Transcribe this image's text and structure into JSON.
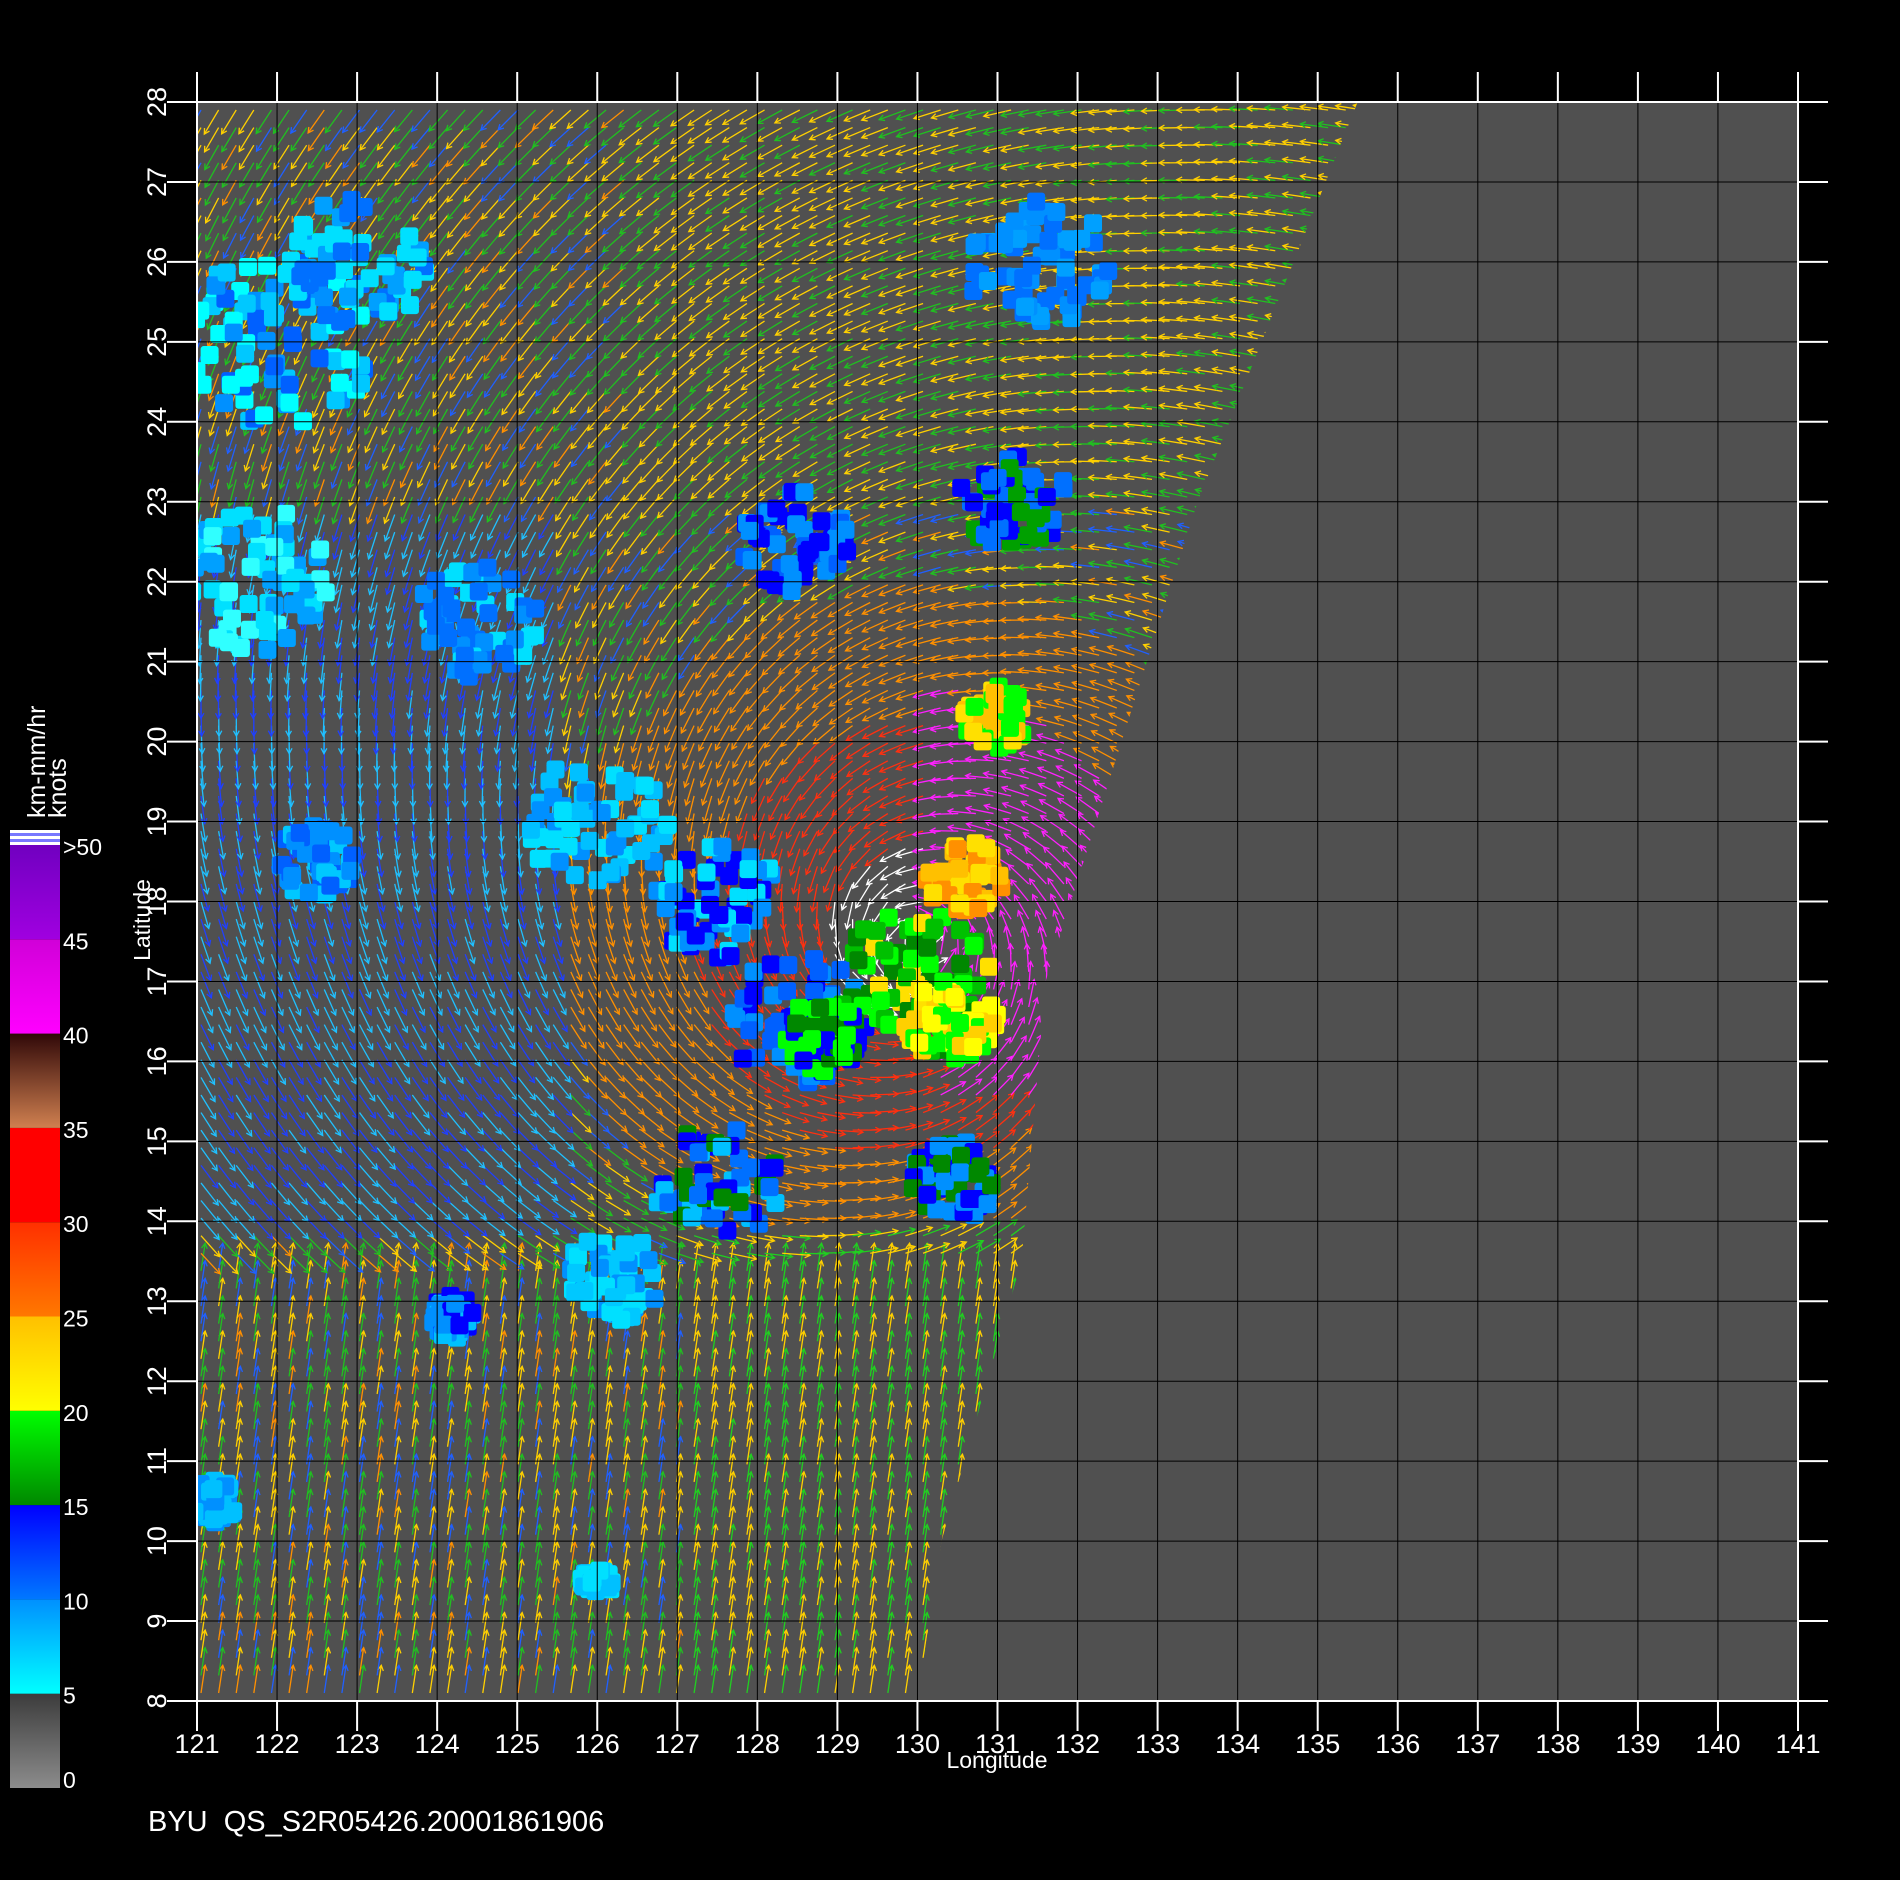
{
  "chart_data": {
    "type": "scatter",
    "x_axis": {
      "label": "Longitude",
      "range": [
        121,
        141
      ],
      "ticks": [
        121,
        122,
        123,
        124,
        125,
        126,
        127,
        128,
        129,
        130,
        131,
        132,
        133,
        134,
        135,
        136,
        137,
        138,
        139,
        140,
        141
      ]
    },
    "y_axis": {
      "label": "Latitude",
      "range": [
        8,
        28
      ],
      "ticks": [
        8,
        9,
        10,
        11,
        12,
        13,
        14,
        15,
        16,
        17,
        18,
        19,
        20,
        21,
        22,
        23,
        24,
        25,
        26,
        27,
        28
      ]
    },
    "grid": true,
    "plot_background": "#505050",
    "caption": "BYU  QS_S2R05426.20001861906",
    "colorbar": {
      "unit_rain": "km-mm/hr",
      "unit_wind": "knots",
      "labels": [
        "0",
        "5",
        "10",
        "15",
        "20",
        "25",
        "30",
        "35",
        "40",
        "45",
        ">50"
      ],
      "bins": [
        {
          "from": 0,
          "to": 5,
          "colors": [
            "#8c8c8c",
            "#3c3c3c"
          ]
        },
        {
          "from": 5,
          "to": 10,
          "colors": [
            "#00ffff",
            "#0090ff"
          ]
        },
        {
          "from": 10,
          "to": 15,
          "colors": [
            "#0078ff",
            "#0000ff"
          ]
        },
        {
          "from": 15,
          "to": 20,
          "colors": [
            "#008800",
            "#00ff00"
          ]
        },
        {
          "from": 20,
          "to": 25,
          "colors": [
            "#ffff00",
            "#ffc000"
          ]
        },
        {
          "from": 25,
          "to": 30,
          "colors": [
            "#ff7800",
            "#ff3000"
          ]
        },
        {
          "from": 30,
          "to": 35,
          "colors": [
            "#ff0000",
            "#ff0000"
          ]
        },
        {
          "from": 35,
          "to": 40,
          "colors": [
            "#d08050",
            "#300808"
          ]
        },
        {
          "from": 40,
          "to": 45,
          "colors": [
            "#ff00ff",
            "#d000d8"
          ]
        },
        {
          "from": 45,
          "to": 50,
          "colors": [
            "#a000e0",
            "#7000c0"
          ]
        }
      ],
      "top_stripes": [
        "#ffffff",
        "#7878ff",
        "#ffffff",
        "#7878ff",
        "#ffffff"
      ]
    },
    "swath": {
      "description_polygon": [
        [
          121,
          28
        ],
        [
          135.5,
          28
        ],
        [
          133.5,
          23
        ],
        [
          131.6,
          17
        ],
        [
          131.3,
          13.5
        ],
        [
          130.3,
          10
        ],
        [
          130,
          8
        ],
        [
          121,
          8
        ]
      ],
      "storm_center": [
        130.0,
        17.5
      ]
    },
    "rain_clusters": [
      {
        "lon": 122.0,
        "lat": 25.0,
        "spread": 1.2,
        "colors": [
          "#00c8ff",
          "#0090ff",
          "#00ffff",
          "#0060ff"
        ]
      },
      {
        "lon": 121.8,
        "lat": 22.0,
        "spread": 1.0,
        "colors": [
          "#00e0ff",
          "#00a0ff",
          "#30ffff"
        ]
      },
      {
        "lon": 123.0,
        "lat": 26.0,
        "spread": 0.9,
        "colors": [
          "#00a0ff",
          "#0070ff",
          "#00e0ff"
        ]
      },
      {
        "lon": 126.0,
        "lat": 19.0,
        "spread": 0.9,
        "colors": [
          "#00e0ff",
          "#00c0ff",
          "#0090ff"
        ]
      },
      {
        "lon": 127.5,
        "lat": 18.0,
        "spread": 0.8,
        "colors": [
          "#0090ff",
          "#00e0ff",
          "#0000ff"
        ]
      },
      {
        "lon": 128.5,
        "lat": 16.5,
        "spread": 0.9,
        "colors": [
          "#0000ff",
          "#0060ff",
          "#0090ff"
        ]
      },
      {
        "lon": 127.5,
        "lat": 14.5,
        "spread": 0.8,
        "colors": [
          "#0000ff",
          "#0070ff",
          "#008800",
          "#00c0ff"
        ]
      },
      {
        "lon": 126.2,
        "lat": 13.3,
        "spread": 0.6,
        "colors": [
          "#00c8ff",
          "#0090ff",
          "#00e0ff"
        ]
      },
      {
        "lon": 130.0,
        "lat": 17.0,
        "spread": 1.0,
        "colors": [
          "#00ff00",
          "#00c000",
          "#008800",
          "#ffe000"
        ]
      },
      {
        "lon": 130.4,
        "lat": 16.5,
        "spread": 0.6,
        "colors": [
          "#ffff00",
          "#ffd000",
          "#00ff00"
        ]
      },
      {
        "lon": 130.6,
        "lat": 18.3,
        "spread": 0.5,
        "colors": [
          "#ffc000",
          "#ff9000",
          "#ffe000"
        ]
      },
      {
        "lon": 131.0,
        "lat": 20.3,
        "spread": 0.45,
        "colors": [
          "#ffc000",
          "#ffe000",
          "#00ff00"
        ]
      },
      {
        "lon": 130.5,
        "lat": 14.5,
        "spread": 0.6,
        "colors": [
          "#0000ff",
          "#0090ff",
          "#008800"
        ]
      },
      {
        "lon": 131.2,
        "lat": 23.0,
        "spread": 0.7,
        "colors": [
          "#0000ff",
          "#0070ff",
          "#00a000"
        ]
      },
      {
        "lon": 124.2,
        "lat": 12.8,
        "spread": 0.3,
        "colors": [
          "#0090ff",
          "#0000ff",
          "#00c0ff"
        ]
      },
      {
        "lon": 122.5,
        "lat": 18.5,
        "spread": 0.5,
        "colors": [
          "#0090ff",
          "#00c8ff",
          "#0060ff"
        ]
      },
      {
        "lon": 124.5,
        "lat": 21.5,
        "spread": 0.8,
        "colors": [
          "#0090ff",
          "#00e0ff",
          "#0070ff"
        ]
      },
      {
        "lon": 131.5,
        "lat": 26.0,
        "spread": 0.9,
        "colors": [
          "#0090ff",
          "#00a0ff",
          "#0070ff"
        ]
      },
      {
        "lon": 128.5,
        "lat": 22.5,
        "spread": 0.7,
        "colors": [
          "#0000ff",
          "#0060ff",
          "#0090ff"
        ]
      },
      {
        "lon": 121.2,
        "lat": 10.5,
        "spread": 0.3,
        "colors": [
          "#0090ff",
          "#00c0ff"
        ]
      },
      {
        "lon": 126.0,
        "lat": 9.5,
        "spread": 0.2,
        "colors": [
          "#00e0ff",
          "#00c0ff"
        ]
      },
      {
        "lon": 128.8,
        "lat": 16.3,
        "spread": 0.5,
        "colors": [
          "#00ff00",
          "#008800",
          "#0000ff"
        ]
      }
    ]
  }
}
